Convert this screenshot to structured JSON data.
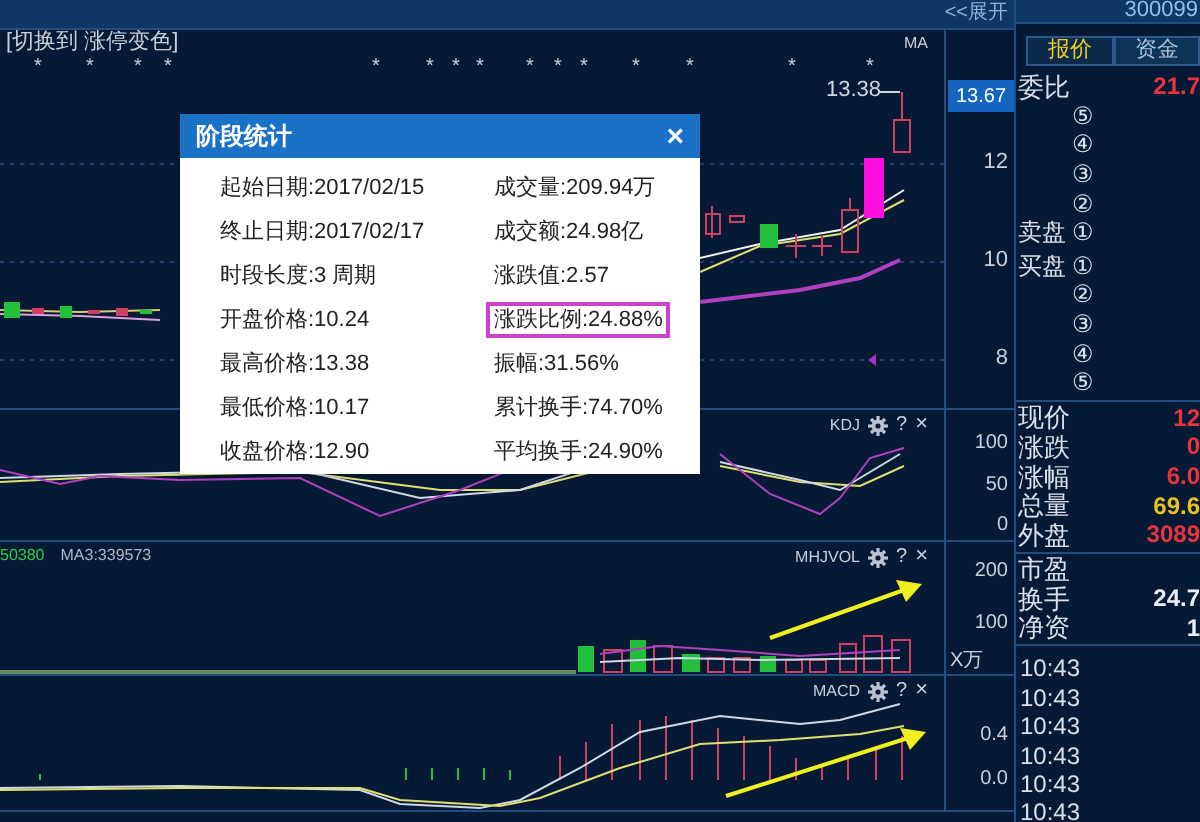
{
  "top_bar": {
    "expand_button": "<<展开"
  },
  "main_chart": {
    "toggle_label": "[切换到 涨停变色]",
    "indicator": "MA",
    "markers": [
      "*",
      "*",
      "*",
      "*",
      "*",
      "*",
      "*",
      "*",
      "*",
      "*",
      "*",
      "*",
      "*",
      "*",
      "*"
    ],
    "high_label": "13.38",
    "current_price": "13.67",
    "axis": [
      "12",
      "10",
      "8"
    ]
  },
  "panels": [
    {
      "kind": "kdj",
      "title": "KDJ",
      "help": "?",
      "close": "×",
      "axis": [
        "100",
        "50",
        "0"
      ]
    },
    {
      "kind": "vol",
      "title": "MHJVOL",
      "help": "?",
      "close": "×",
      "values": [
        {
          "text": "50380",
          "color": "#2ecc40"
        },
        {
          "text": "MA3:339573",
          "color": "#b0b8c8"
        }
      ],
      "axis": [
        "200",
        "100"
      ],
      "unit": "X万"
    },
    {
      "kind": "macd",
      "title": "MACD",
      "help": "?",
      "close": "×",
      "axis": [
        "0.4",
        "0.0"
      ]
    }
  ],
  "dialog": {
    "title": "阶段统计",
    "close": "×",
    "left": [
      {
        "text": "起始日期:2017/02/15",
        "highlighted": false
      },
      {
        "text": "终止日期:2017/02/17",
        "highlighted": false
      },
      {
        "text": "时段长度:3 周期",
        "highlighted": false
      },
      {
        "text": "开盘价格:10.24",
        "highlighted": false
      },
      {
        "text": "最高价格:13.38",
        "highlighted": false
      },
      {
        "text": "最低价格:10.17",
        "highlighted": false
      },
      {
        "text": "收盘价格:12.90",
        "highlighted": false
      }
    ],
    "right": [
      {
        "text": "成交量:209.94万",
        "highlighted": false
      },
      {
        "text": "成交额:24.98亿",
        "highlighted": false
      },
      {
        "text": "涨跌值:2.57",
        "highlighted": false
      },
      {
        "text": "涨跌比例:24.88%",
        "highlighted": true
      },
      {
        "text": "振幅:31.56%",
        "highlighted": false
      },
      {
        "text": "累计换手:74.70%",
        "highlighted": false
      },
      {
        "text": "平均换手:24.90%",
        "highlighted": false
      }
    ]
  },
  "quote_panel": {
    "code": "300099",
    "tabs": [
      {
        "label": "报价",
        "selected": true
      },
      {
        "label": "资金",
        "selected": false
      }
    ],
    "ratio": {
      "label": "委比",
      "value": "21.7"
    },
    "asks": [
      {
        "num": "⑤"
      },
      {
        "num": "④"
      },
      {
        "num": "③"
      },
      {
        "num": "②"
      },
      {
        "label": "卖盘",
        "num": "①"
      }
    ],
    "bids": [
      {
        "label": "买盘",
        "num": "①"
      },
      {
        "num": "②"
      },
      {
        "num": "③"
      },
      {
        "num": "④"
      },
      {
        "num": "⑤"
      }
    ],
    "stats": [
      {
        "label": "现价",
        "value": "12",
        "color": "#e8343c"
      },
      {
        "label": "涨跌",
        "value": "0",
        "color": "#e8343c"
      },
      {
        "label": "涨幅",
        "value": "6.0",
        "color": "#e8343c"
      },
      {
        "label": "总量",
        "value": "69.6",
        "color": "#e8c020"
      },
      {
        "label": "外盘",
        "value": "3089",
        "color": "#e8343c"
      }
    ],
    "stats2": [
      {
        "label": "市盈"
      },
      {
        "label": "换手",
        "value": "24.7"
      },
      {
        "label": "净资",
        "value": "1"
      }
    ],
    "times": [
      "10:43",
      "10:43",
      "10:43",
      "10:43",
      "10:43",
      "10:43"
    ]
  }
}
